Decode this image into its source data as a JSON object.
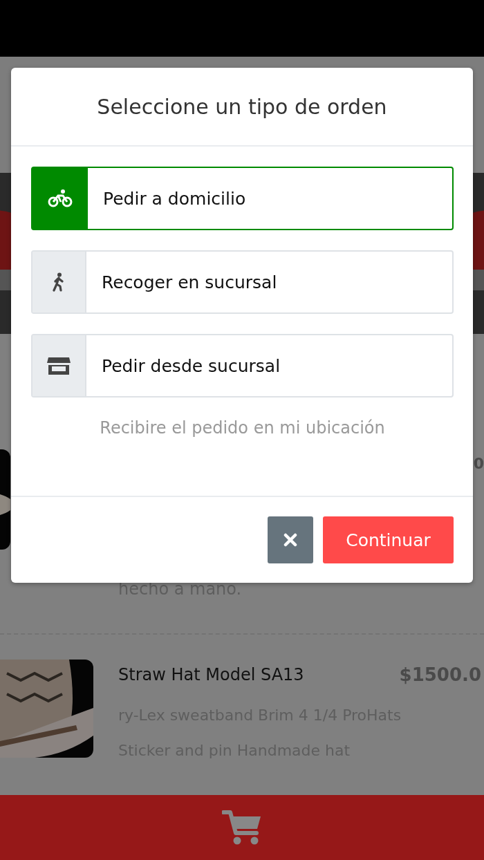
{
  "modal": {
    "title": "Seleccione un tipo de orden",
    "options": [
      {
        "kind": "bike",
        "label": "Pedir a domicilio",
        "selected": true
      },
      {
        "kind": "walk",
        "label": "Recoger en sucursal",
        "selected": false
      },
      {
        "kind": "store",
        "label": "Pedir desde sucursal",
        "selected": false
      }
    ],
    "hint": "Recibire el pedido en mi ubicación",
    "continue_button": "Continuar"
  },
  "products": [
    {
      "price": "0",
      "description": [
        "hecho a mano."
      ]
    },
    {
      "title": "Straw Hat Model SA13",
      "price": "$1500.0",
      "description": [
        "ry-Lex sweatband Brim 4 1/4 ProHats",
        "Sticker and pin Handmade hat"
      ]
    }
  ]
}
